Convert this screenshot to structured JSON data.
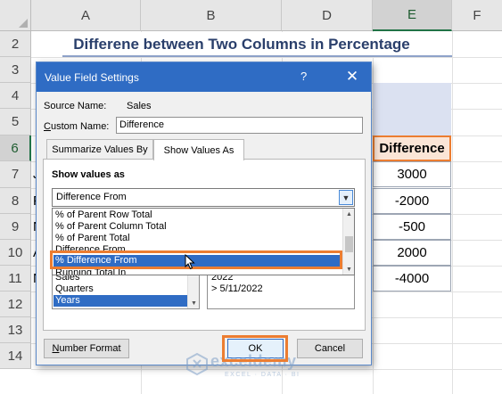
{
  "sheet": {
    "columns": [
      "A",
      "B",
      "D",
      "E",
      "F"
    ],
    "rows": [
      "2",
      "3",
      "4",
      "5",
      "6",
      "7",
      "8",
      "9",
      "10",
      "11",
      "12",
      "13",
      "14"
    ],
    "title": "Differene between Two Columns in Percentage",
    "difference_header": "Difference",
    "difference_values": [
      "3000",
      "-2000",
      "-500",
      "2000",
      "-4000"
    ],
    "row_peek": [
      "J",
      "F",
      "N",
      "A",
      "N"
    ]
  },
  "dialog": {
    "title": "Value Field Settings",
    "help": "?",
    "close": "✕",
    "source_name_label": "Source Name:",
    "source_name_value": "Sales",
    "custom_name_label_first": "C",
    "custom_name_label_rest": "ustom Name:",
    "custom_name_value": "Difference",
    "tabs": [
      "Summarize Values By",
      "Show Values As"
    ],
    "show_values_as_label": "Show values as",
    "selected_calculation": "Difference From",
    "dropdown_options": [
      "% of Parent Row Total",
      "% of Parent Column Total",
      "% of Parent Total",
      "Difference From",
      "% Difference From",
      "Running Total In"
    ],
    "base_field_items": [
      "Sales",
      "Quarters",
      "Years"
    ],
    "base_item_items": [
      "2022",
      "> 5/11/2022"
    ],
    "number_format_first": "N",
    "number_format_rest": "umber Format",
    "ok": "OK",
    "cancel": "Cancel"
  },
  "watermark": {
    "name": "exceldemy",
    "tagline": "EXCEL · DATA · BI"
  },
  "colors": {
    "accent": "#2f6cc4",
    "highlight_border": "#ec7d31",
    "title_text": "#2a3f6b"
  }
}
